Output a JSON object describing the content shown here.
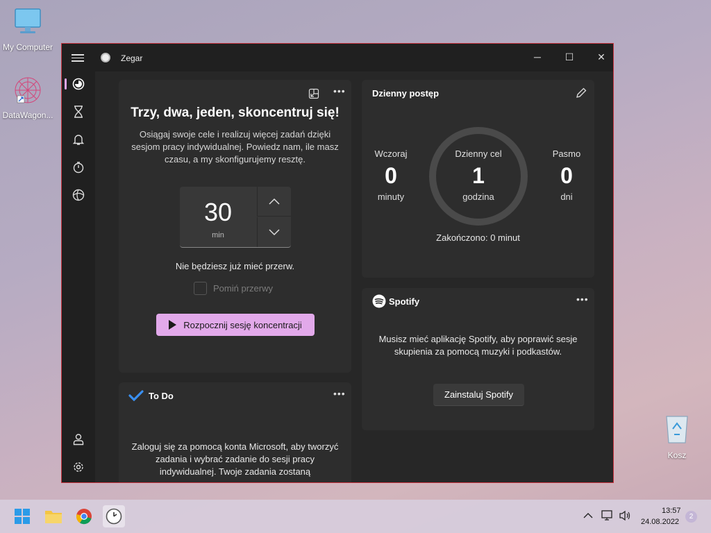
{
  "desktop": {
    "icons": [
      {
        "label": "My Computer"
      },
      {
        "label": "DataWagon..."
      },
      {
        "label": "Kosz"
      }
    ]
  },
  "window": {
    "title": "Zegar",
    "controls": {
      "minimize": "─",
      "maximize": "☐",
      "close": "✕"
    }
  },
  "sidebar": {
    "items": [
      {
        "name": "Sesje koncentracji",
        "icon": "focus-icon",
        "active": true
      },
      {
        "name": "Czasomierz",
        "icon": "hourglass-icon"
      },
      {
        "name": "Alarm",
        "icon": "bell-icon"
      },
      {
        "name": "Stoper",
        "icon": "stopwatch-icon"
      },
      {
        "name": "Zegar światowy",
        "icon": "globe-icon"
      }
    ],
    "bottom": [
      {
        "name": "Konto",
        "icon": "account-icon"
      },
      {
        "name": "Ustawienia",
        "icon": "settings-icon"
      }
    ]
  },
  "focus": {
    "title": "Trzy, dwa, jeden, skoncentruj się!",
    "description": "Osiągaj swoje cele i realizuj więcej zadań dzięki sesjom pracy indywidualnej. Powiedz nam, ile masz czasu, a my skonfigurujemy resztę.",
    "minutes": "30",
    "unit": "min",
    "no_break_text": "Nie będziesz już mieć przerw.",
    "skip_label": "Pomiń przerwy",
    "start_label": "Rozpocznij sesję koncentracji"
  },
  "progress": {
    "header": "Dzienny postęp",
    "yesterday": {
      "label": "Wczoraj",
      "value": "0",
      "unit": "minuty"
    },
    "goal": {
      "label": "Dzienny cel",
      "value": "1",
      "unit": "godzina"
    },
    "streak": {
      "label": "Pasmo",
      "value": "0",
      "unit": "dni"
    },
    "completed": "Zakończono: 0 minut"
  },
  "spotify": {
    "header": "Spotify",
    "message": "Musisz mieć aplikację Spotify, aby poprawić sesje skupienia za pomocą muzyki i podkastów.",
    "install_label": "Zainstaluj Spotify"
  },
  "todo": {
    "header": "To Do",
    "message": "Zaloguj się za pomocą konta Microsoft, aby tworzyć zadania i wybrać zadanie do sesji pracy indywidualnej. Twoje zadania zostaną"
  },
  "taskbar": {
    "apps": [
      "start-icon",
      "file-explorer-icon",
      "chrome-icon",
      "clock-app-icon"
    ],
    "time": "13:57",
    "date": "24.08.2022",
    "notifications": "2"
  }
}
